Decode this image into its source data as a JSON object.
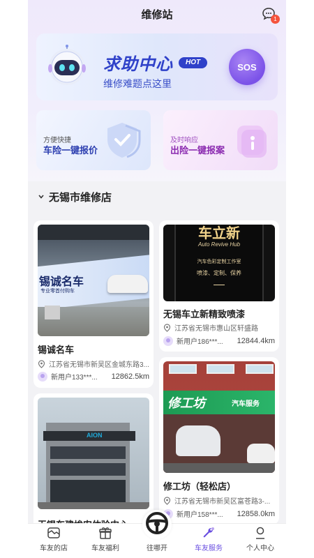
{
  "header": {
    "title": "维修站",
    "msg_badge": "1"
  },
  "help_banner": {
    "title": "求助中心",
    "hot": "HOT",
    "subtitle": "维修难题点这里",
    "sos": "SOS"
  },
  "quick_cards": [
    {
      "small": "方便快捷",
      "big": "车险一键报价"
    },
    {
      "small": "及时响应",
      "big": "出险一键报案"
    }
  ],
  "section": {
    "title": "无锡市维修店"
  },
  "shops": [
    {
      "photo_text": "锡诚名车",
      "photo_sub": "专业零首付购车",
      "name": "锡诚名车",
      "address": "江苏省无锡市新吴区金城东路3...",
      "user": "新用户133***...",
      "distance": "12862.5km"
    },
    {
      "photo_text": "车立新",
      "photo_sub": "Auto Revive Hub",
      "photo_line": "汽车色彩定制工作室",
      "photo_line2": "喷漆、定制、保养",
      "name": "无锡车立新精致喷漆",
      "address": "江苏省无锡市惠山区轩盛路",
      "user": "新用户186***...",
      "distance": "12844.4km"
    },
    {
      "photo_text": "AION",
      "name": "无锡车建埃安体验中心",
      "address": "",
      "user": "",
      "distance": ""
    },
    {
      "photo_text": "修工坊",
      "photo_sub": "汽车服务",
      "name": "修工坊（轻松店）",
      "address": "江苏省无锡市新吴区富苍路3-...",
      "user": "新用户158***...",
      "distance": "12858.0km"
    }
  ],
  "tabbar": [
    {
      "label": "车友的店",
      "icon": "store-icon"
    },
    {
      "label": "车友福利",
      "icon": "gift-icon"
    },
    {
      "label": "往哪开",
      "icon": "steering-wheel-icon"
    },
    {
      "label": "车友服务",
      "icon": "wrench-icon",
      "active": true
    },
    {
      "label": "个人中心",
      "icon": "person-icon"
    }
  ],
  "colors": {
    "accent": "#6a4fe0",
    "brand_blue": "#2f41c9",
    "badge": "#f5533d"
  }
}
